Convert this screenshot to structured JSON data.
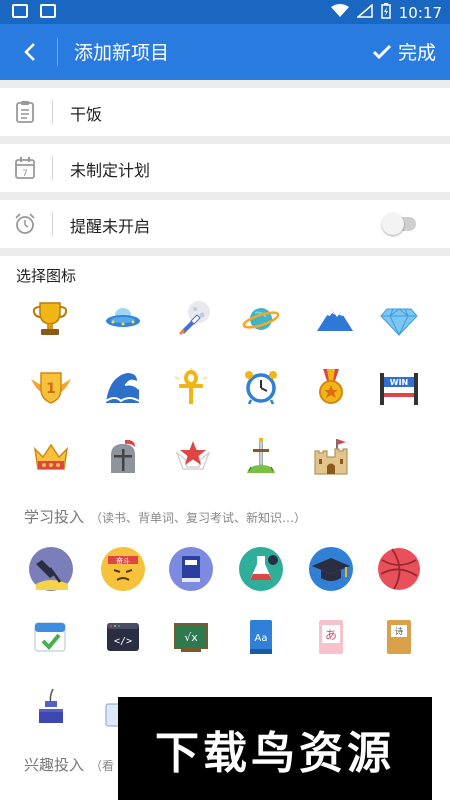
{
  "status_bar": {
    "time": "10:17"
  },
  "app_bar": {
    "title": "添加新项目",
    "done_label": "完成"
  },
  "fields": {
    "name": {
      "value": "干饭",
      "icon": "clipboard-icon"
    },
    "plan": {
      "value": "未制定计划",
      "icon": "calendar-icon"
    },
    "reminder": {
      "value": "提醒未开启",
      "icon": "alarm-clock-icon",
      "enabled": false
    }
  },
  "choose_icon": {
    "title": "选择图标",
    "icons": [
      "trophy-icon",
      "ufo-icon",
      "rocket-moon-icon",
      "planet-icon",
      "mountain-icon",
      "diamond-icon",
      "first-place-wings-icon",
      "wave-icon",
      "ankh-icon",
      "alarm-clock-icon",
      "medal-icon",
      "win-finish-line-icon",
      "crown-icon",
      "knight-helmet-icon",
      "star-crown-icon",
      "sword-in-stone-icon",
      "castle-icon"
    ]
  },
  "study": {
    "title": "学习投入",
    "hint": "（读书、背单词、复习考试、新知识…）",
    "icons": [
      "desk-lamp-icon",
      "struggle-face-icon",
      "book-icon",
      "lab-flask-icon",
      "graduation-cap-icon",
      "basketball-icon",
      "calendar-check-icon",
      "code-terminal-icon",
      "math-blackboard-icon",
      "dictionary-icon",
      "japanese-card-icon",
      "notebook-icon",
      "ink-bottle-icon"
    ]
  },
  "hobby": {
    "title": "兴趣投入",
    "hint": "（看"
  },
  "watermark": {
    "text": "下载鸟资源"
  },
  "colors": {
    "status_bar": "#1a67c1",
    "app_bar": "#2a7be0",
    "divider_gap": "#ececec"
  }
}
